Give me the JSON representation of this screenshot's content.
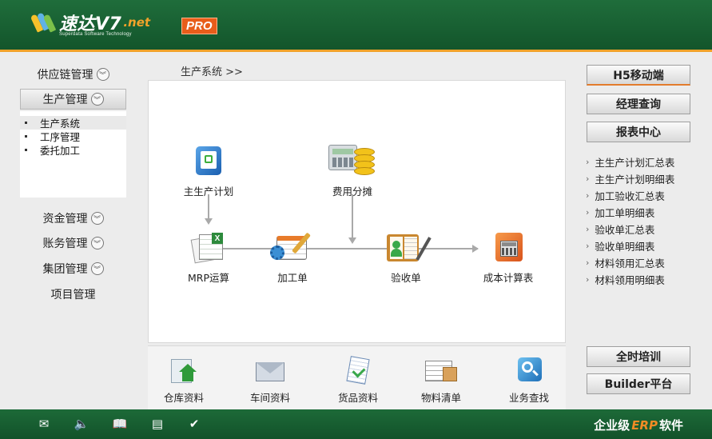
{
  "header": {
    "logo_text": "速达V7",
    "logo_net": ".net",
    "logo_sub": "Superdata Software Technology",
    "pro_badge": "PRO"
  },
  "sidebar": {
    "items": [
      {
        "label": "供应链管理"
      },
      {
        "label": "生产管理"
      },
      {
        "label": "资金管理"
      },
      {
        "label": "账务管理"
      },
      {
        "label": "集团管理"
      },
      {
        "label": "项目管理"
      }
    ],
    "submenu": [
      "生产系统",
      "工序管理",
      "委托加工"
    ]
  },
  "breadcrumb": "生产系统 >>",
  "flow": {
    "master_plan": "主生产计划",
    "cost_alloc": "费用分摊",
    "mrp": "MRP运算",
    "process_order": "加工单",
    "inspection": "验收单",
    "cost_sheet": "成本计算表"
  },
  "quick_links": [
    "仓库资料",
    "车间资料",
    "货品资料",
    "物料清单",
    "业务查找"
  ],
  "right_panel": {
    "mobile": "H5移动端",
    "manager_query": "经理查询",
    "report_center": "报表中心",
    "reports": [
      "主生产计划汇总表",
      "主生产计划明细表",
      "加工验收汇总表",
      "加工单明细表",
      "验收单汇总表",
      "验收单明细表",
      "材料领用汇总表",
      "材料领用明细表"
    ],
    "training": "全时培训",
    "builder": "Builder平台"
  },
  "footer": {
    "brand_pre": "企业级",
    "brand_erp": "ERP",
    "brand_post": "软件"
  },
  "colors": {
    "header_green": "#1f6d3b",
    "accent_orange": "#f0a22a",
    "pro_orange": "#e85d1a"
  }
}
